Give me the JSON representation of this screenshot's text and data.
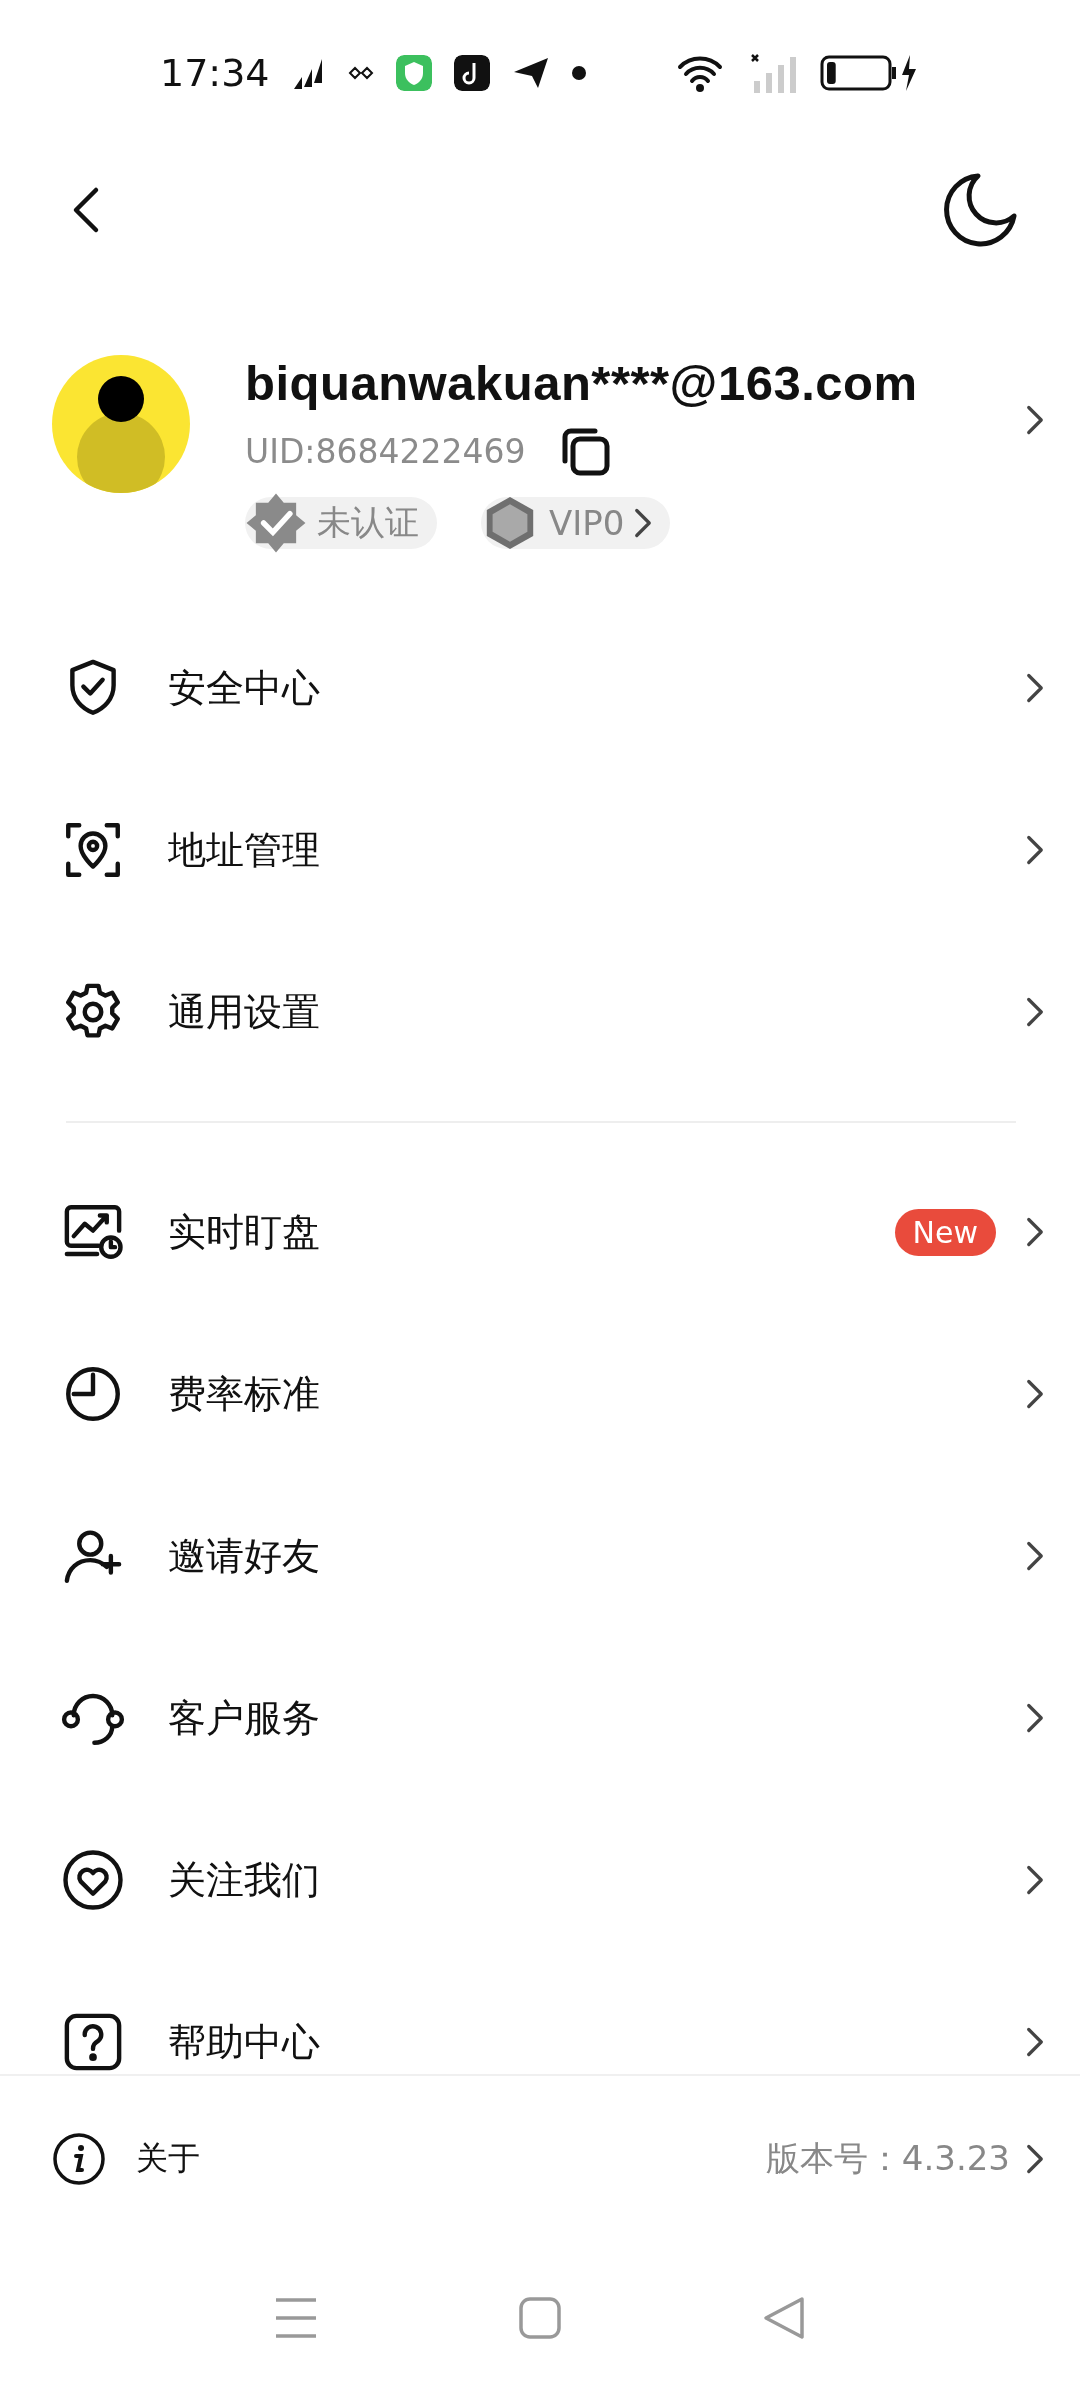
{
  "status_bar": {
    "time": "17:34",
    "battery": {
      "level": 0.15,
      "charging": true
    }
  },
  "profile": {
    "email": "biquanwakuan****@163.com",
    "uid": "UID:8684222469",
    "badges": [
      {
        "kind": "verify",
        "label": "未认证"
      },
      {
        "kind": "vip",
        "label": "VIP0"
      }
    ]
  },
  "menu_groups": [
    [
      {
        "kind": "shield",
        "label": "安全中心"
      },
      {
        "kind": "location",
        "label": "地址管理"
      },
      {
        "kind": "gear",
        "label": "通用设置"
      }
    ],
    [
      {
        "kind": "monitor",
        "label": "实时盯盘",
        "badge": "New"
      },
      {
        "kind": "clock",
        "label": "费率标准"
      },
      {
        "kind": "person-add",
        "label": "邀请好友"
      },
      {
        "kind": "headset",
        "label": "客户服务"
      },
      {
        "kind": "heart",
        "label": "关注我们"
      },
      {
        "kind": "question",
        "label": "帮助中心"
      }
    ]
  ],
  "footer": {
    "label": "关于",
    "version": "版本号：4.3.23"
  }
}
